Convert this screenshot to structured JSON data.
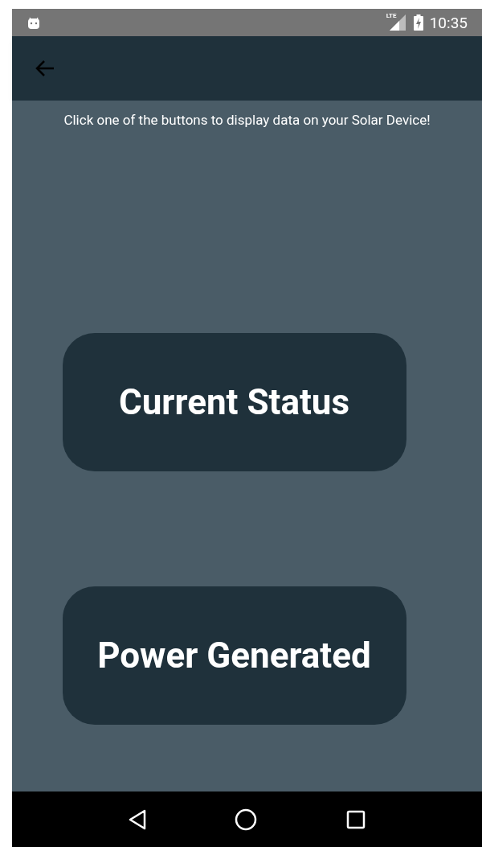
{
  "status_bar": {
    "time": "10:35",
    "network": "LTE"
  },
  "message": "Click one of the buttons to display data on your Solar Device!",
  "buttons": [
    "Current Status",
    "Power Generated"
  ]
}
